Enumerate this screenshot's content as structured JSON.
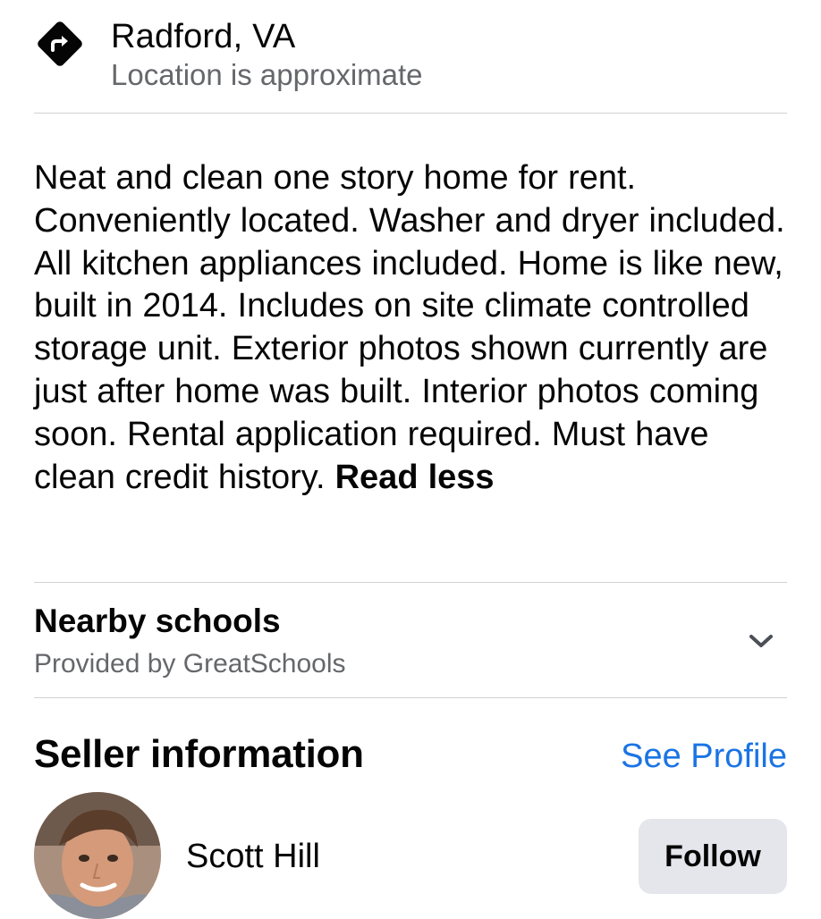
{
  "location": {
    "city": "Radford, VA",
    "note": "Location is approximate",
    "icon": "directions-icon"
  },
  "description": {
    "text": "Neat and clean one story home for rent.  Conveniently located.  Washer and dryer included.  All kitchen appliances included.  Home is like new, built in 2014.  Includes on site climate controlled storage unit.  Exterior photos shown currently are just after home was built.  Interior photos coming soon.  Rental application required.  Must have clean credit history.",
    "read_less_label": "Read less"
  },
  "schools": {
    "title": "Nearby schools",
    "subtitle": "Provided by GreatSchools",
    "icon": "chevron-down-icon"
  },
  "seller": {
    "section_title": "Seller information",
    "see_profile_label": "See Profile",
    "name": "Scott Hill",
    "follow_label": "Follow"
  },
  "colors": {
    "link": "#1b74e4",
    "secondary_text": "#65676b",
    "divider": "#d0d2d6",
    "button_bg": "#e4e6eb"
  }
}
